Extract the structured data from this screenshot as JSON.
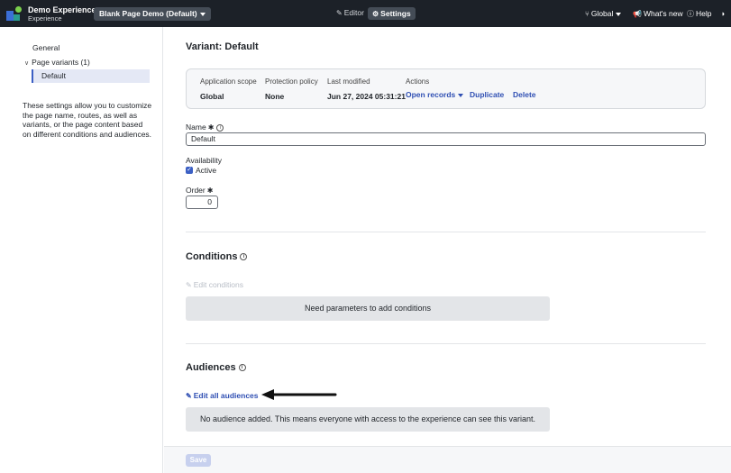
{
  "topbar": {
    "app_name": "Demo Experience",
    "app_subtitle": "Experience",
    "page_selector": "Blank Page Demo (Default)",
    "editor_label": "Editor",
    "settings_label": "Settings",
    "scope_label": "Global",
    "whats_new_label": "What's new",
    "help_label": "Help"
  },
  "sidebar": {
    "general": "General",
    "page_variants": "Page variants (1)",
    "default_variant": "Default",
    "description": "These settings allow you to customize the page name, routes, as well as variants, or the page content based on different conditions and audiences."
  },
  "main": {
    "title": "Variant: Default",
    "summary": {
      "application_scope_label": "Application scope",
      "application_scope_value": "Global",
      "protection_policy_label": "Protection policy",
      "protection_policy_value": "None",
      "last_modified_label": "Last modified",
      "last_modified_value": "Jun 27, 2024 05:31:21",
      "actions_label": "Actions",
      "open_records": "Open records",
      "duplicate": "Duplicate",
      "delete": "Delete"
    },
    "name_label": "Name",
    "name_value": "Default",
    "availability_label": "Availability",
    "active_label": "Active",
    "order_label": "Order",
    "order_value": "0",
    "conditions_title": "Conditions",
    "edit_conditions": "Edit conditions",
    "conditions_empty": "Need parameters to add conditions",
    "audiences_title": "Audiences",
    "edit_audiences": "Edit all audiences",
    "audiences_empty": "No audience added. This means everyone with access to the experience can see this variant."
  },
  "footer": {
    "save_label": "Save"
  },
  "colors": {
    "topbar_bg": "#1c2128",
    "link": "#2f4fb3",
    "accent": "#3b5fc4"
  }
}
